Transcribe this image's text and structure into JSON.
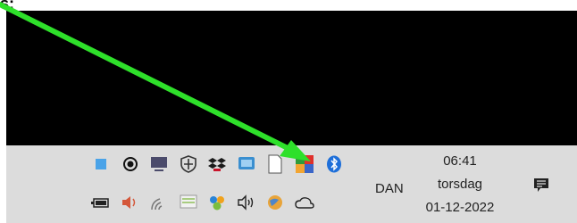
{
  "annotation": {
    "label": "s:"
  },
  "tray": {
    "row1_icons": [
      "blue-square-icon",
      "record-icon",
      "monitor-icon",
      "shield-icon",
      "dropbox-icon",
      "app-icon",
      "document-icon",
      "colorful-app-icon",
      "bluetooth-icon"
    ],
    "row2_icons": [
      "battery-icon",
      "volume-icon",
      "wifi-icon",
      "network-icon",
      "people-icon",
      "speaker-icon",
      "globe-icon",
      "cloud-icon"
    ],
    "language": "DAN",
    "clock": {
      "time": "06:41",
      "day": "torsdag",
      "date": "01-12-2022"
    }
  },
  "colors": {
    "arrow": "#2ee02a",
    "taskbar": "#dcdcdc",
    "desktop": "#000000"
  }
}
